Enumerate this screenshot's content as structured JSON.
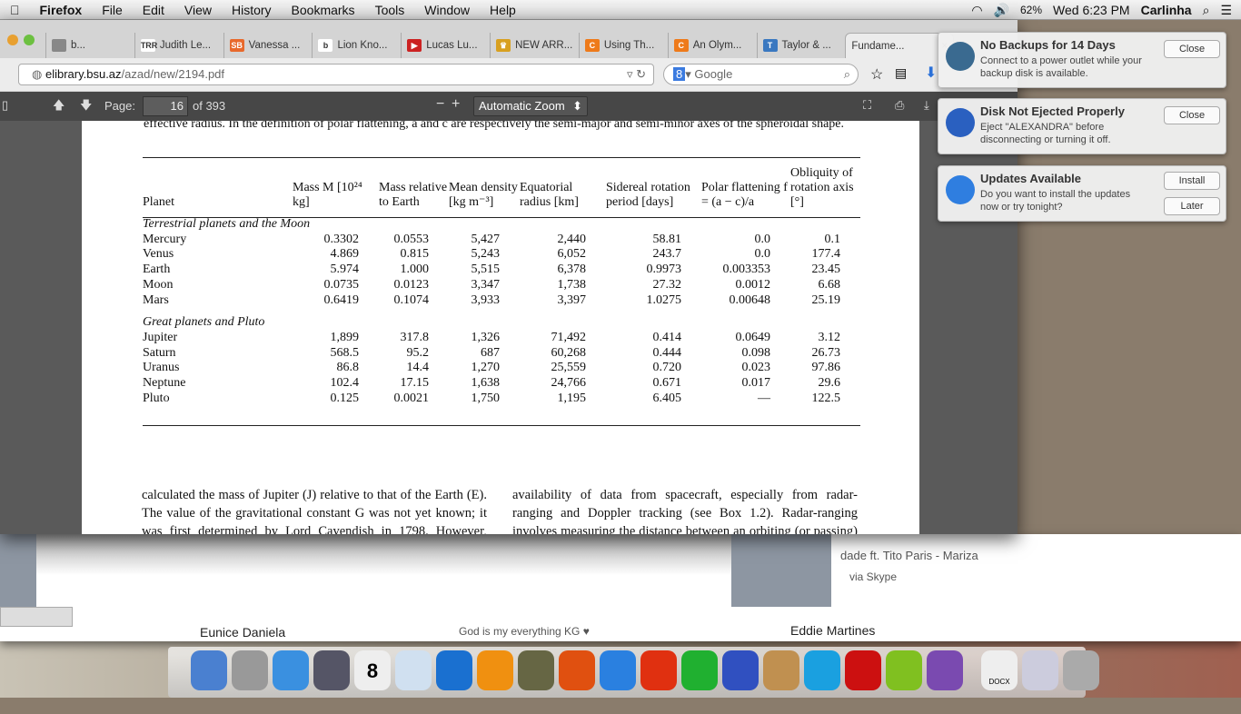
{
  "menubar": {
    "app": "Firefox",
    "items": [
      "File",
      "Edit",
      "View",
      "History",
      "Bookmarks",
      "Tools",
      "Window",
      "Help"
    ],
    "battery": "62%",
    "clock": "Wed 6:23 PM",
    "user": "Carlinha"
  },
  "tabs": [
    {
      "label": "b...",
      "color": "#888",
      "fav": ""
    },
    {
      "label": "Judith Le...",
      "color": "#fff",
      "fav": "TRR"
    },
    {
      "label": "Vanessa ...",
      "color": "#e8692c",
      "fav": "SB"
    },
    {
      "label": "Lion Kno...",
      "color": "#fff",
      "fav": "b"
    },
    {
      "label": "Lucas Lu...",
      "color": "#cc2222",
      "fav": "▶"
    },
    {
      "label": "NEW ARR...",
      "color": "#d8a020",
      "fav": "♛"
    },
    {
      "label": "Using Th...",
      "color": "#ee7a1a",
      "fav": "C"
    },
    {
      "label": "An Olym...",
      "color": "#ee7a1a",
      "fav": "C"
    },
    {
      "label": "Taylor & ...",
      "color": "#3a78c0",
      "fav": "T"
    },
    {
      "label": "Fundame...",
      "color": "#fff",
      "fav": "",
      "active": true
    }
  ],
  "nav": {
    "url_host": "elibrary.bsu.az",
    "url_path": "/azad/new/2194.pdf",
    "search_placeholder": "Google"
  },
  "pdf": {
    "page_label": "Page:",
    "page": "16",
    "of": "of 393",
    "zoom": "Automatic Zoom"
  },
  "doc": {
    "caption": "effective radius. In the definition of polar flattening, a and c are respectively the semi-major and semi-minor axes of the spheroidal shape.",
    "headers": [
      "Planet",
      "Mass M [10²⁴ kg]",
      "Mass relative to Earth",
      "Mean density [kg m⁻³]",
      "Equatorial radius [km]",
      "Sidereal rotation period [days]",
      "Polar flattening f = (a − c)/a",
      "Obliquity of rotation axis [°]"
    ],
    "sections": [
      {
        "title": "Terrestrial planets and the Moon",
        "rows": [
          [
            "Mercury",
            "0.3302",
            "0.0553",
            "5,427",
            "2,440",
            "58.81",
            "0.0",
            "0.1"
          ],
          [
            "Venus",
            "4.869",
            "0.815",
            "5,243",
            "6,052",
            "243.7",
            "0.0",
            "177.4"
          ],
          [
            "Earth",
            "5.974",
            "1.000",
            "5,515",
            "6,378",
            "0.9973",
            "0.003353",
            "23.45"
          ],
          [
            "Moon",
            "0.0735",
            "0.0123",
            "3,347",
            "1,738",
            "27.32",
            "0.0012",
            "6.68"
          ],
          [
            "Mars",
            "0.6419",
            "0.1074",
            "3,933",
            "3,397",
            "1.0275",
            "0.00648",
            "25.19"
          ]
        ]
      },
      {
        "title": "Great planets and Pluto",
        "rows": [
          [
            "Jupiter",
            "1,899",
            "317.8",
            "1,326",
            "71,492",
            "0.414",
            "0.0649",
            "3.12"
          ],
          [
            "Saturn",
            "568.5",
            "95.2",
            "687",
            "60,268",
            "0.444",
            "0.098",
            "26.73"
          ],
          [
            "Uranus",
            "86.8",
            "14.4",
            "1,270",
            "25,559",
            "0.720",
            "0.023",
            "97.86"
          ],
          [
            "Neptune",
            "102.4",
            "17.15",
            "1,638",
            "24,766",
            "0.671",
            "0.017",
            "29.6"
          ],
          [
            "Pluto",
            "0.125",
            "0.0021",
            "1,750",
            "1,195",
            "6.405",
            "—",
            "122.5"
          ]
        ]
      }
    ],
    "col1": "calculated the mass of Jupiter (J) relative to that of the Earth (E). The value of the gravitational constant G was not yet known; it was first determined by Lord Cavendish in 1798. However, Newton calculated the value of GJ to",
    "col2": "availability of data from spacecraft, especially from radar-ranging and Doppler tracking (see Box 1.2). Radar-ranging involves measuring the distance between an orbiting (or passing) spacecraft and the planet's surface from the two-"
  },
  "notifications": [
    {
      "title": "No Backups for 14 Days",
      "message": "Connect to a power outlet while your backup disk is available.",
      "buttons": [
        "Close"
      ],
      "icon": "time-machine-icon"
    },
    {
      "title": "Disk Not Ejected Properly",
      "message": "Eject \"ALEXANDRA\" before disconnecting or turning it off.",
      "buttons": [
        "Close"
      ],
      "icon": "disk-icon"
    },
    {
      "title": "Updates Available",
      "message": "Do you want to install the updates now or try tonight?",
      "buttons": [
        "Install",
        "Later"
      ],
      "icon": "app-store-icon"
    }
  ],
  "background": {
    "song": "dade ft. Tito Paris - Mariza",
    "via": "via Skype",
    "contacts": [
      "Eunice Daniela",
      "God is my everything KG ♥",
      "Eddie Martines"
    ]
  },
  "dock": {
    "calendar_day": "8",
    "docx_label": "DOCX"
  }
}
